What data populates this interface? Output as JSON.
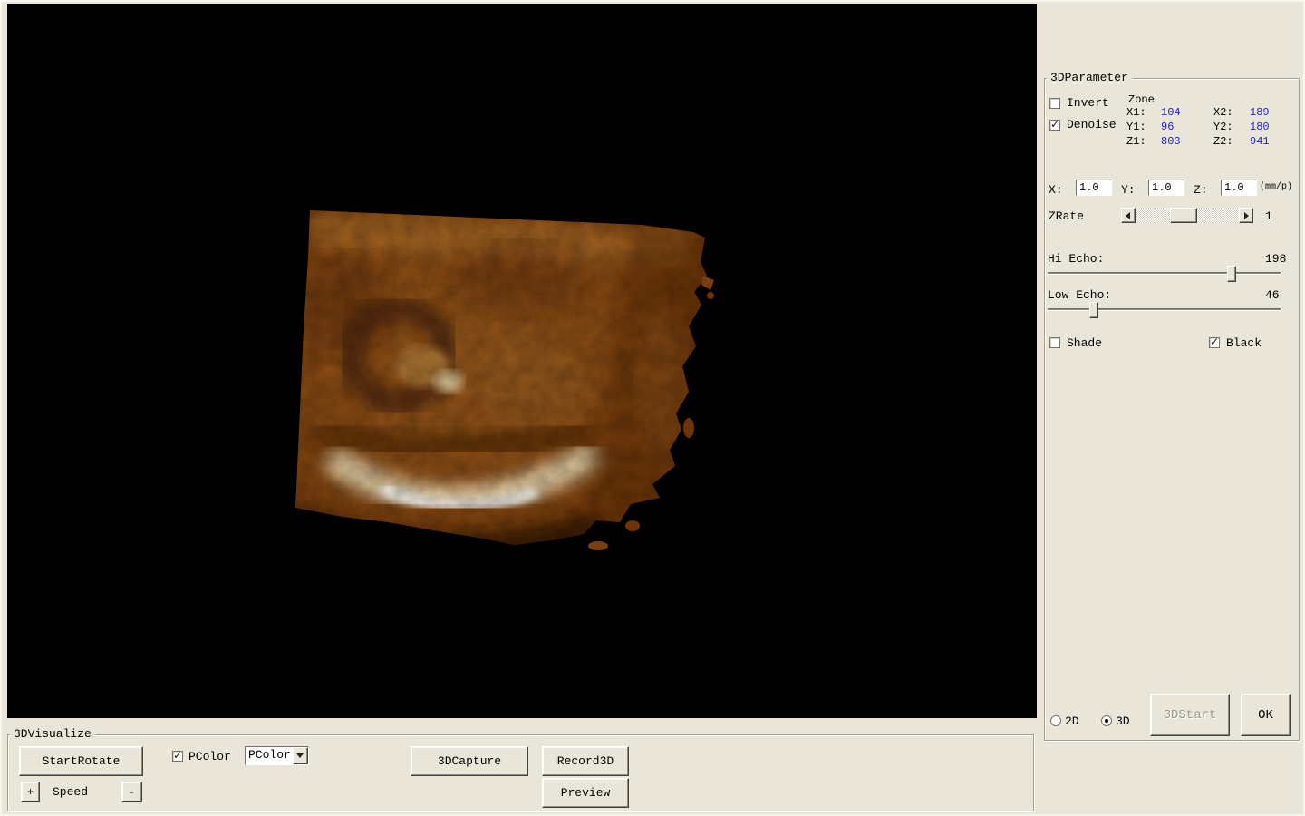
{
  "colors": {
    "value_blue": "#2323C8"
  },
  "parameter_panel": {
    "title": "3DParameter",
    "invert": {
      "label": "Invert",
      "checked": false
    },
    "denoise": {
      "label": "Denoise",
      "checked": true
    },
    "zone": {
      "title": "Zone",
      "x1_label": "X1:",
      "x1_value": "104",
      "x2_label": "X2:",
      "x2_value": "189",
      "y1_label": "Y1:",
      "y1_value": "96",
      "y2_label": "Y2:",
      "y2_value": "180",
      "z1_label": "Z1:",
      "z1_value": "803",
      "z2_label": "Z2:",
      "z2_value": "941"
    },
    "scale": {
      "x_label": "X:",
      "x_value": "1.0",
      "y_label": "Y:",
      "y_value": "1.0",
      "z_label": "Z:",
      "z_value": "1.0",
      "unit": "(mm/p)"
    },
    "zrate": {
      "label": "ZRate",
      "value": "1"
    },
    "hi_echo": {
      "label": "Hi Echo:",
      "value": "198"
    },
    "low_echo": {
      "label": "Low Echo:",
      "value": "46"
    },
    "shade": {
      "label": "Shade",
      "checked": false
    },
    "black": {
      "label": "Black",
      "checked": true
    },
    "mode": {
      "d2_label": "2D",
      "d2_selected": false,
      "d3_label": "3D",
      "d3_selected": true
    },
    "buttons": {
      "start": "3DStart",
      "start_enabled": false,
      "ok": "OK"
    }
  },
  "visualize_panel": {
    "title": "3DVisualize",
    "start_rotate": "StartRotate",
    "pcolor": {
      "label": "PColor",
      "checked": true
    },
    "pcolor_select": {
      "value": "PColor"
    },
    "capture": "3DCapture",
    "record": "Record3D",
    "preview": "Preview",
    "speed": {
      "plus": "+",
      "label": "Speed",
      "minus": "-"
    }
  }
}
